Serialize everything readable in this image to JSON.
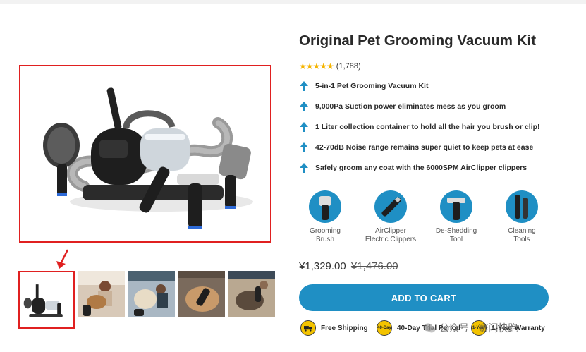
{
  "product": {
    "title": "Original Pet Grooming Vacuum Kit",
    "stars": "★★★★★",
    "rating_count": "(1,788)",
    "features": [
      "5-in-1 Pet Grooming Vacuum Kit",
      "9,000Pa Suction power eliminates mess as you groom",
      "1 Liter collection container to hold all the hair you brush or clip!",
      "42-70dB Noise range remains super quiet to keep pets at ease",
      "Safely groom any coat with the 6000SPM AirClipper clippers"
    ],
    "tools": [
      {
        "line1": "Grooming",
        "line2": "Brush",
        "icon": "grooming-brush-icon"
      },
      {
        "line1": "AirClipper",
        "line2": "Electric Clippers",
        "icon": "clipper-icon"
      },
      {
        "line1": "De-Shedding",
        "line2": "Tool",
        "icon": "deshedding-tool-icon"
      },
      {
        "line1": "Cleaning",
        "line2": "Tools",
        "icon": "cleaning-tools-icon"
      }
    ],
    "price": "¥1,329.00",
    "old_price": "¥1,476.00",
    "cart_label": "ADD TO CART",
    "badges": [
      {
        "seal": "",
        "label": "Free Shipping",
        "icon": "truck-seal-icon"
      },
      {
        "seal": "40-Day",
        "label": "40-Day Trial Period",
        "icon": "trial-seal-icon"
      },
      {
        "seal": "1-Year",
        "label": "1-Year Warranty",
        "icon": "warranty-seal-icon"
      }
    ]
  },
  "watermark": {
    "text": "公众号 · 赛闪快跑"
  },
  "colors": {
    "accent": "#1f8fc4",
    "star": "#f5b400",
    "highlight_border": "#e02020",
    "seal": "#f3c300"
  }
}
